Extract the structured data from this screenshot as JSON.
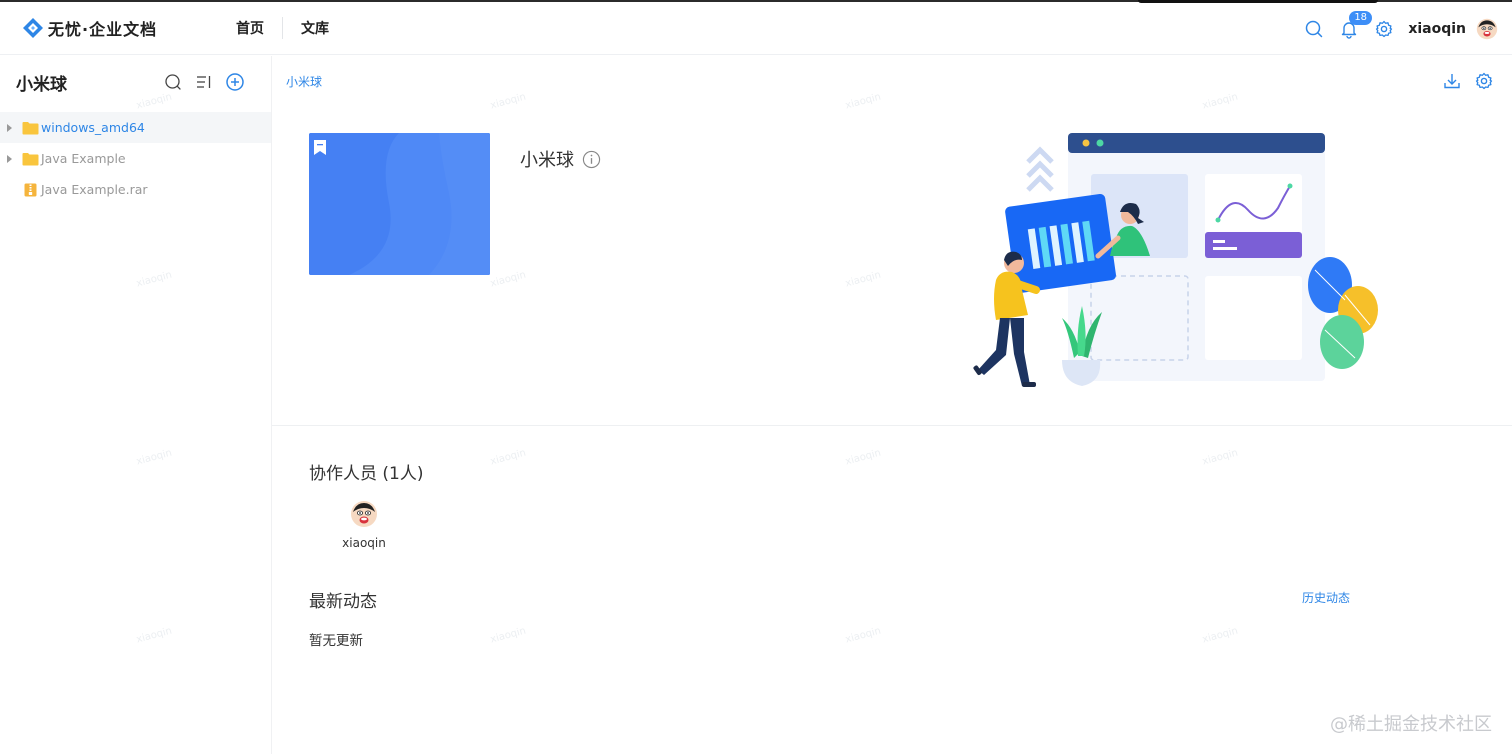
{
  "header": {
    "logo_text": "无忧·企业文档",
    "nav": [
      {
        "label": "首页"
      },
      {
        "label": "文库"
      }
    ],
    "notification_count": "18",
    "username": "xiaoqin"
  },
  "sidebar": {
    "title": "小米球",
    "tree": [
      {
        "label": "windows_amd64",
        "type": "folder",
        "expandable": true,
        "active": true
      },
      {
        "label": "Java Example",
        "type": "folder",
        "expandable": true,
        "active": false
      },
      {
        "label": "Java Example.rar",
        "type": "archive",
        "expandable": false,
        "active": false
      }
    ]
  },
  "main": {
    "breadcrumb": "小米球",
    "title": "小米球",
    "collaborators_title": "协作人员 (1人)",
    "collaborators": [
      {
        "name": "xiaoqin"
      }
    ],
    "activity_title": "最新动态",
    "history_link": "历史动态",
    "empty_text": "暂无更新"
  },
  "watermark_text": "xiaoqin",
  "footer_credit": "@稀土掘金技术社区",
  "colors": {
    "accent": "#2e86e6",
    "cover": "#4580f3",
    "badge": "#3d8ef7"
  }
}
